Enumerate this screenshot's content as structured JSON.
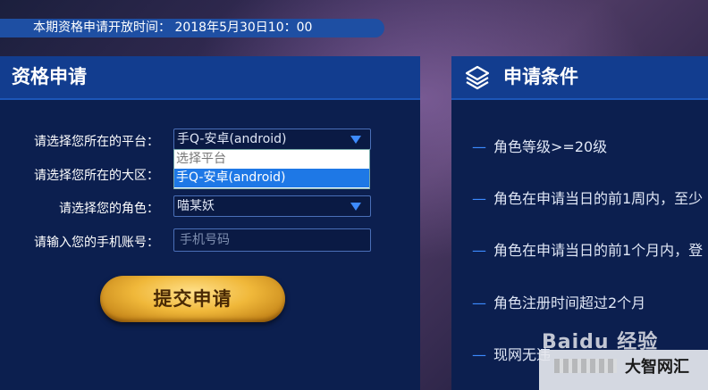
{
  "topbar": {
    "text": "本期资格申请开放时间： 2018年5月30日10：00"
  },
  "left_panel": {
    "title": "资格申请",
    "platform_label": "请选择您所在的平台：",
    "platform_value": "手Q-安卓(android)",
    "platform_options": [
      "选择平台",
      "手Q-安卓(android)"
    ],
    "region_label": "请选择您所在的大区：",
    "role_label": "请选择您的角色：",
    "role_value": "喵某妖",
    "phone_label": "请输入您的手机账号：",
    "phone_placeholder": "手机号码",
    "submit_label": "提交申请"
  },
  "right_panel": {
    "title": "申请条件",
    "conditions": [
      "角色等级>=20级",
      "角色在申请当日的前1周内，至少",
      "角色在申请当日的前1个月内，登",
      "角色注册时间超过2个月",
      "现网无违"
    ]
  },
  "watermark": {
    "text": "Baidu 经验",
    "brand": "大智网汇"
  },
  "colors": {
    "accent": "#3d8bff",
    "panel": "#0c1f4f",
    "header": "#123d8f",
    "topbar": "#1e4fa3"
  }
}
